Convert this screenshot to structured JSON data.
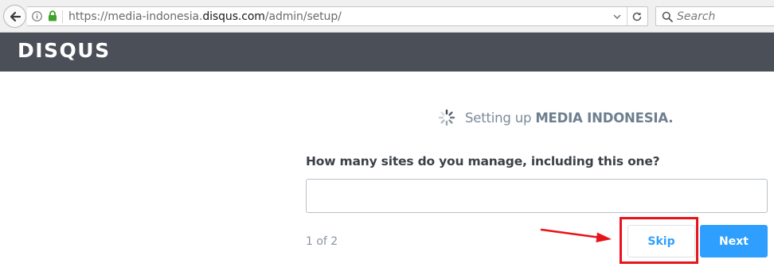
{
  "browser": {
    "url_prefix": "https://media-indonesia.",
    "url_domain": "disqus.com",
    "url_suffix": "/admin/setup/",
    "search_placeholder": "Search"
  },
  "header": {
    "logo_text": "DISQUS",
    "background_color": "#4a4f58"
  },
  "setup": {
    "status_prefix": "Setting up ",
    "site_name": "MEDIA INDONESIA.",
    "question": "How many sites do you manage, including this one?",
    "answer_value": "",
    "step": "1 of 2",
    "skip_label": "Skip",
    "next_label": "Next",
    "accent_color": "#2e9fff"
  },
  "annotation": {
    "color": "#e8141b"
  }
}
